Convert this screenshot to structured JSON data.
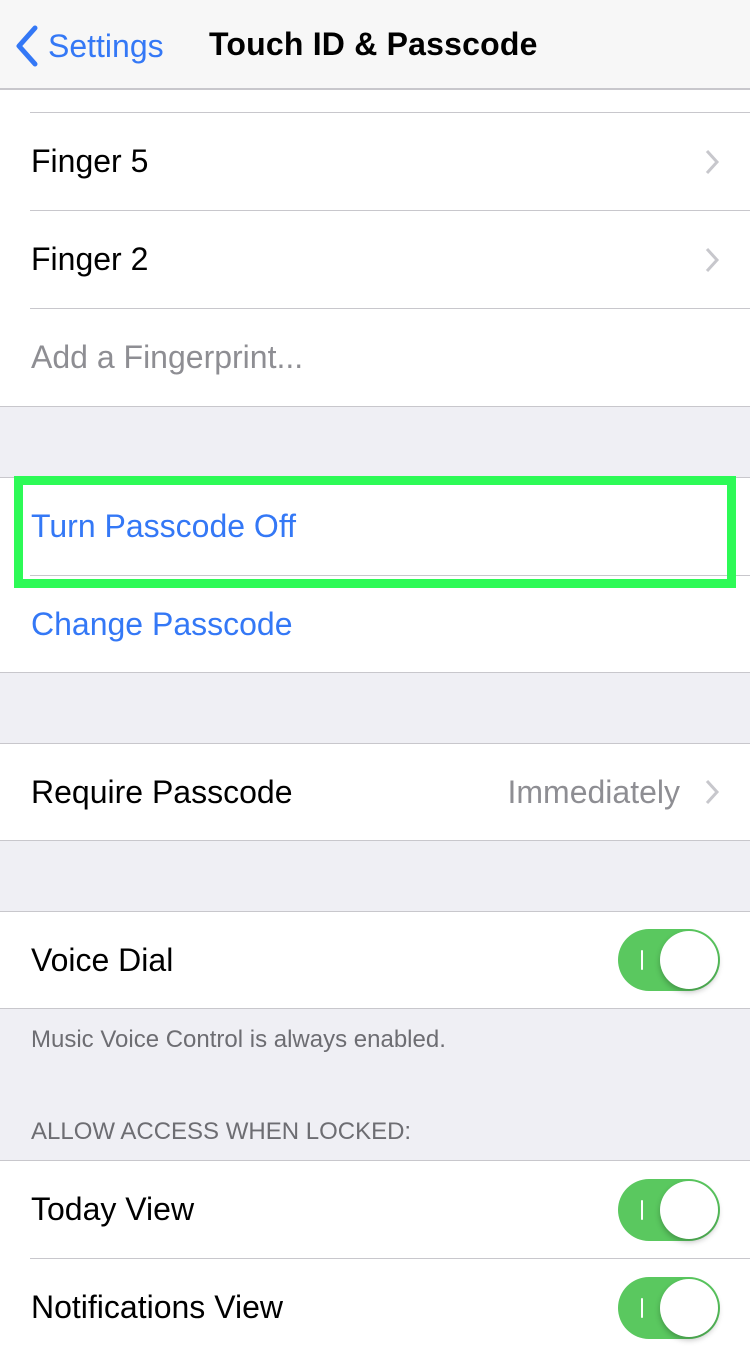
{
  "nav": {
    "back_label": "Settings",
    "title": "Touch ID & Passcode"
  },
  "fingerprints": [
    {
      "label": "Finger 5"
    },
    {
      "label": "Finger 2"
    }
  ],
  "add_fingerprint": "Add a Fingerprint...",
  "passcode": {
    "turn_off": "Turn Passcode Off",
    "change": "Change Passcode"
  },
  "require_passcode": {
    "label": "Require Passcode",
    "value": "Immediately"
  },
  "voice_dial": {
    "label": "Voice Dial",
    "on": true,
    "footnote": "Music Voice Control is always enabled."
  },
  "locked_access": {
    "header": "ALLOW ACCESS WHEN LOCKED:",
    "items": [
      {
        "label": "Today View",
        "on": true
      },
      {
        "label": "Notifications View",
        "on": true
      }
    ]
  },
  "colors": {
    "accent": "#3478f6",
    "toggle_on": "#5ac85f",
    "highlight": "#2dfa56"
  }
}
